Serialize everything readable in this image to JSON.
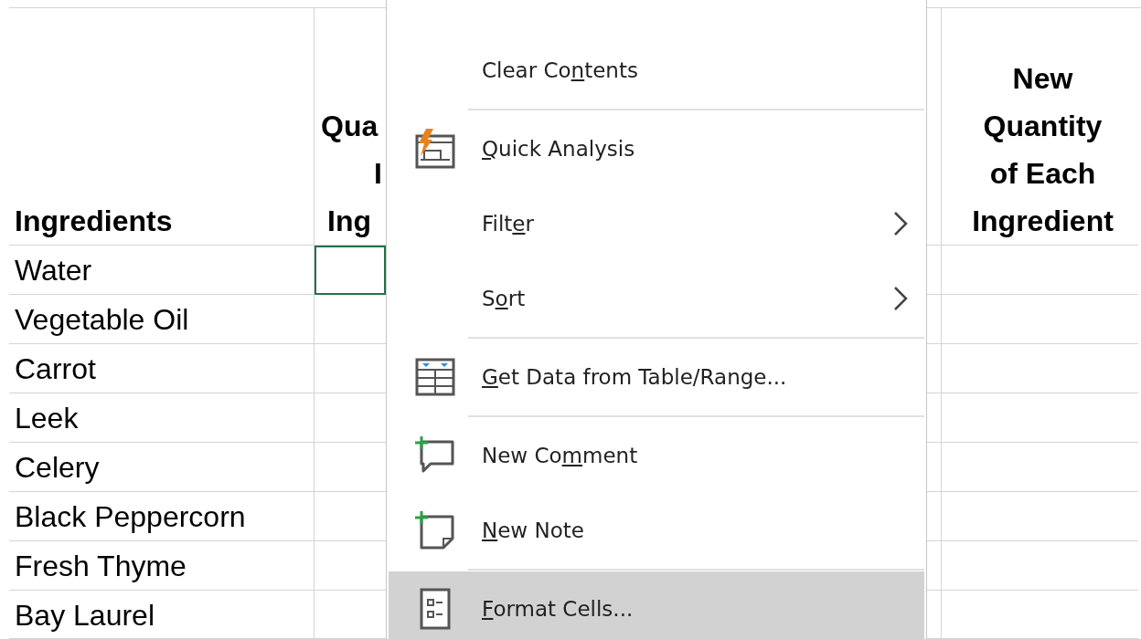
{
  "sheet": {
    "columns": [
      {
        "header": "Ingredients"
      },
      {
        "header_fragments": [
          "Qua",
          "I",
          "Ing"
        ]
      },
      {
        "header": "New Quantity of Each Ingredient"
      }
    ],
    "rows": [
      {
        "ingredient": "Water",
        "selected": true
      },
      {
        "ingredient": "Vegetable Oil",
        "selected": false
      },
      {
        "ingredient": "Carrot",
        "selected": false
      },
      {
        "ingredient": "Leek",
        "selected": false
      },
      {
        "ingredient": "Celery",
        "selected": false
      },
      {
        "ingredient": "Black Peppercorn",
        "selected": false
      },
      {
        "ingredient": "Fresh Thyme",
        "selected": false
      },
      {
        "ingredient": "Bay Laurel",
        "selected": false
      }
    ]
  },
  "context_menu": {
    "items": [
      {
        "kind": "plain",
        "label": {
          "before": "Clear Co",
          "key": "n",
          "after": "tents"
        },
        "highlighted": false
      },
      {
        "kind": "separator"
      },
      {
        "kind": "quick_analysis",
        "label": {
          "key": "Q",
          "after": "uick Analysis"
        },
        "highlighted": false
      },
      {
        "kind": "submenu",
        "label": {
          "before": "Filt",
          "key": "e",
          "after": "r"
        },
        "highlighted": false
      },
      {
        "kind": "submenu",
        "label": {
          "before": "S",
          "key": "o",
          "after": "rt"
        },
        "highlighted": false
      },
      {
        "kind": "separator"
      },
      {
        "kind": "table_data",
        "label": {
          "key": "G",
          "after": "et Data from Table/Range..."
        },
        "highlighted": false
      },
      {
        "kind": "separator"
      },
      {
        "kind": "comment",
        "label": {
          "before": "New Co",
          "key": "m",
          "after": "ment"
        },
        "highlighted": false
      },
      {
        "kind": "note",
        "label": {
          "key": "N",
          "after": "ew Note"
        },
        "highlighted": false
      },
      {
        "kind": "separator"
      },
      {
        "kind": "format",
        "label": {
          "key": "F",
          "after": "ormat Cells..."
        },
        "highlighted": true
      }
    ]
  }
}
